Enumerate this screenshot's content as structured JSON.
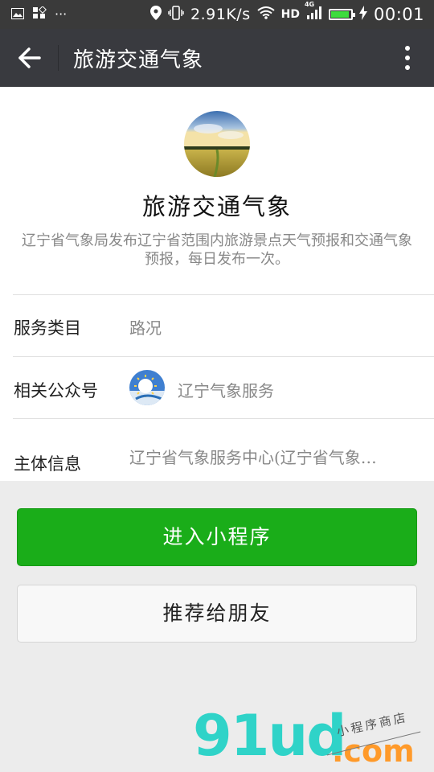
{
  "status_bar": {
    "speed": "2.91K/s",
    "network": "HD",
    "network_gen": "4G",
    "time": "00:01",
    "icons": [
      "image-icon",
      "apps-icon",
      "more-dots-icon",
      "location-icon",
      "vibrate-icon",
      "wifi-icon",
      "signal-icon",
      "battery-icon",
      "charging-icon"
    ]
  },
  "header": {
    "title": "旅游交通气象",
    "back_icon": "arrow-left-icon",
    "more_icon": "more-vertical-icon"
  },
  "profile": {
    "name": "旅游交通气象",
    "description": "辽宁省气象局发布辽宁省范围内旅游景点天气预报和交通气象预报，每日发布一次。"
  },
  "info_rows": [
    {
      "label": "服务类目",
      "value": "路况"
    },
    {
      "label": "相关公众号",
      "value": "辽宁气象服务"
    },
    {
      "label": "主体信息",
      "value": "辽宁省气象服务中心(辽宁省气象…"
    }
  ],
  "actions": {
    "enter_label": "进入小程序",
    "share_label": "推荐给朋友"
  },
  "watermark": {
    "logo": "91ud",
    "domain": ".com",
    "tagline": "小程序商店"
  },
  "colors": {
    "title_bar": "#393a3f",
    "status_bar": "#3a3a3a",
    "primary_green": "#1aad19",
    "battery_green": "#3ddc3d",
    "watermark_teal": "#2fd3c8",
    "watermark_orange": "#ff9a2a"
  }
}
